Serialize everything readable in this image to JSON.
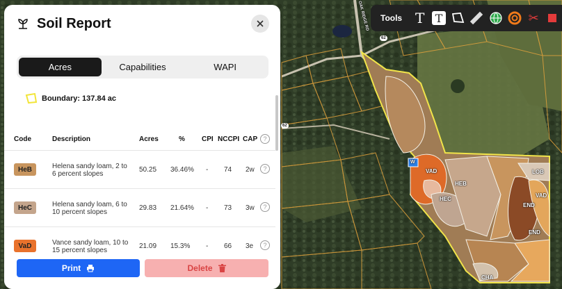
{
  "panel": {
    "title": "Soil Report",
    "tabs": [
      {
        "label": "Acres",
        "active": true
      },
      {
        "label": "Capabilities",
        "active": false
      },
      {
        "label": "WAPI",
        "active": false
      }
    ],
    "boundary": "Boundary: 137.84 ac",
    "columns": [
      "Code",
      "Description",
      "Acres",
      "%",
      "CPI",
      "NCCPI",
      "CAP"
    ],
    "rows": [
      {
        "code": "HeB",
        "color": "#c8955e",
        "description": "Helena sandy loam, 2 to 6 percent slopes",
        "acres": "50.25",
        "percent": "36.46%",
        "cpi": "-",
        "nccpi": "74",
        "cap": "2w"
      },
      {
        "code": "HeC",
        "color": "#c4a58c",
        "description": "Helena sandy loam, 6 to 10 percent slopes",
        "acres": "29.83",
        "percent": "21.64%",
        "cpi": "-",
        "nccpi": "73",
        "cap": "3w"
      },
      {
        "code": "VaD",
        "color": "#e9722c",
        "description": "Vance sandy loam, 10 to 15 percent slopes",
        "acres": "21.09",
        "percent": "15.3%",
        "cpi": "-",
        "nccpi": "66",
        "cap": "3e"
      }
    ],
    "print_label": "Print",
    "delete_label": "Delete"
  },
  "toolbar": {
    "label": "Tools",
    "tools": [
      "text-tool-icon",
      "text-box-tool-icon",
      "polygon-tool-icon",
      "ruler-tool-icon",
      "globe-tool-icon",
      "buffer-ring-tool-icon",
      "scissors-tool-icon",
      "layers-tool-icon"
    ]
  },
  "map": {
    "road_labels": [
      "62",
      "62"
    ],
    "soil_labels": [
      "W",
      "VAD",
      "HEB",
      "HEC",
      "LOB",
      "VAD",
      "END",
      "END",
      "CHA"
    ],
    "road_name": "OAK RIDGE RD"
  }
}
